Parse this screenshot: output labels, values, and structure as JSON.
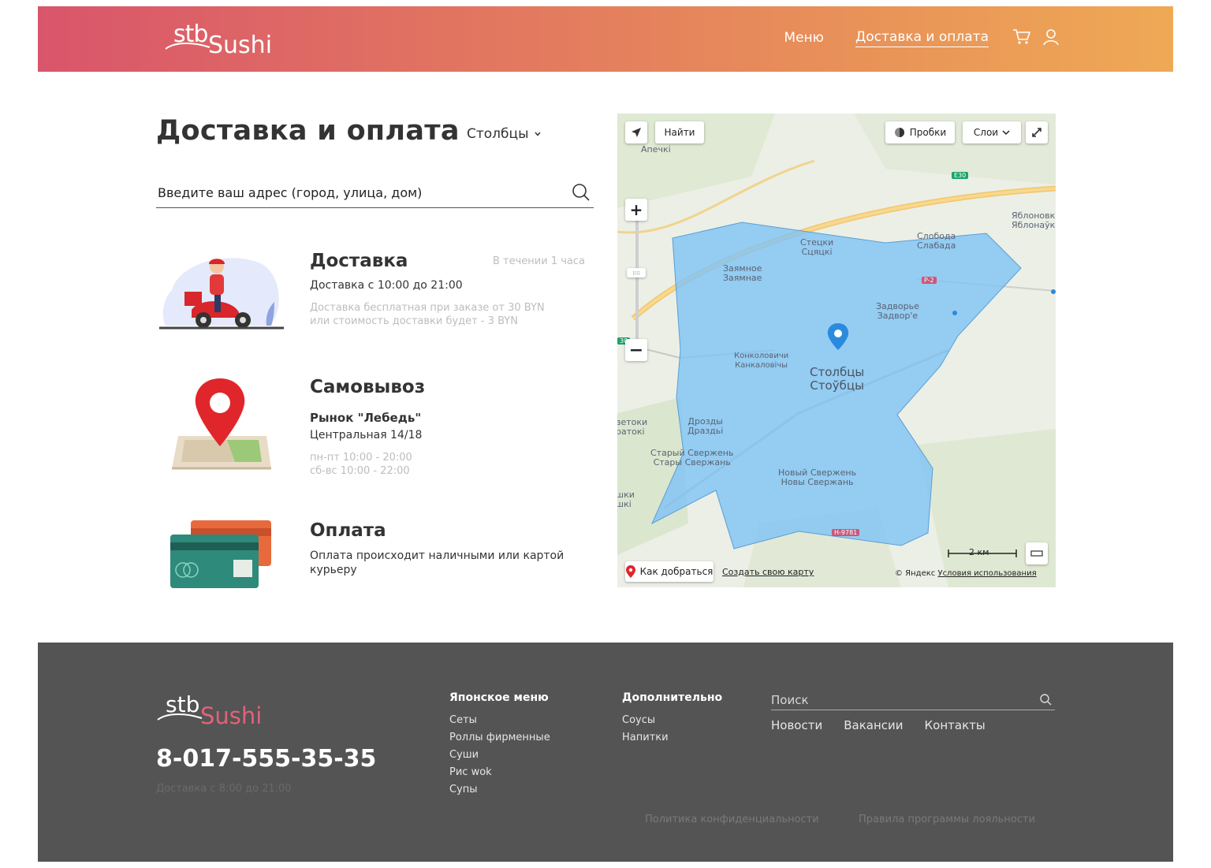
{
  "header": {
    "logo_stb": "stb",
    "logo_sushi": "Sushi",
    "nav": [
      {
        "label": "Меню"
      },
      {
        "label": "Доставка и оплата"
      }
    ]
  },
  "main": {
    "title": "Доставка и оплата",
    "city": "Столбцы",
    "search_placeholder": "Введите ваш адрес (город, улица, дом)",
    "delivery": {
      "title": "Доставка",
      "time": "В течении 1 часа",
      "hours": "Доставка с 10:00 до 21:00",
      "note1": "Доставка бесплатная при заказе от 30 BYN",
      "note2": "или стоимость доставки будет - 3 BYN"
    },
    "pickup": {
      "title": "Самовывоз",
      "place": "Рынок \"Лебедь\"",
      "address": "Центральная 14/18",
      "weekdays": "пн-пт 10:00 - 20:00",
      "weekend": "сб-вс 10:00 - 22:00"
    },
    "payment": {
      "title": "Оплата",
      "text1": "Оплата происходит наличными или картой",
      "text2": "курьеру"
    }
  },
  "map": {
    "find": "Найти",
    "traffic": "Пробки",
    "layers": "Слои",
    "route": "Как добраться",
    "create_map": "Создать свою карту",
    "copyright": "© Яндекс",
    "terms": "Условия использования",
    "scale": "2 км",
    "road_e30": "E30",
    "road_p2": "P-2",
    "road_h9781": "H-9781",
    "road_30": "30",
    "labels": {
      "apechki": [
        "Апечкі"
      ],
      "yablonovka": [
        "Яблоновк",
        "Яблонаўк"
      ],
      "stetski": [
        "Стецки",
        "Сцяцкі"
      ],
      "sloboda": [
        "Слобода",
        "Слабада"
      ],
      "zayamnoe": [
        "Заямное",
        "Заямнае"
      ],
      "zadvorye": [
        "Задворье",
        "Задвор'е"
      ],
      "konkolovichi": [
        "Конколовичи",
        "Канкаловічы"
      ],
      "stolbtsy": [
        "Столбцы",
        "Стоўбцы"
      ],
      "zetoki": [
        "ветоки",
        "ратокі"
      ],
      "drozdy": [
        "Дрозды",
        "Драздьі"
      ],
      "stary_sverzhen": [
        "Старый Свержень",
        "Стары Свержань"
      ],
      "novy_sverzhen": [
        "Новый Свержень",
        "Новы Свержань"
      ],
      "shki": [
        "шки",
        "шкі"
      ]
    }
  },
  "footer": {
    "logo_stb": "stb",
    "logo_sushi": "Sushi",
    "phone": "8-017-555-35-35",
    "hours": "Доставка с 8:00 до 21:00",
    "col1": {
      "head": "Японское меню",
      "items": [
        "Сеты",
        "Роллы фирменные",
        "Суши",
        "Рис wok",
        "Супы"
      ]
    },
    "col2": {
      "head": "Дополнительно",
      "items": [
        "Соусы",
        "Напитки"
      ]
    },
    "search_placeholder": "Поиск",
    "links": [
      "Новости",
      "Вакансии",
      "Контакты"
    ],
    "privacy": "Политика конфиденциальности",
    "loyalty": "Правила программы лояльности"
  },
  "colors": {
    "header_start": "#d9556b",
    "header_end": "#efa955",
    "footer_bg": "#545454",
    "zone_fill": "#7ec3f5"
  }
}
